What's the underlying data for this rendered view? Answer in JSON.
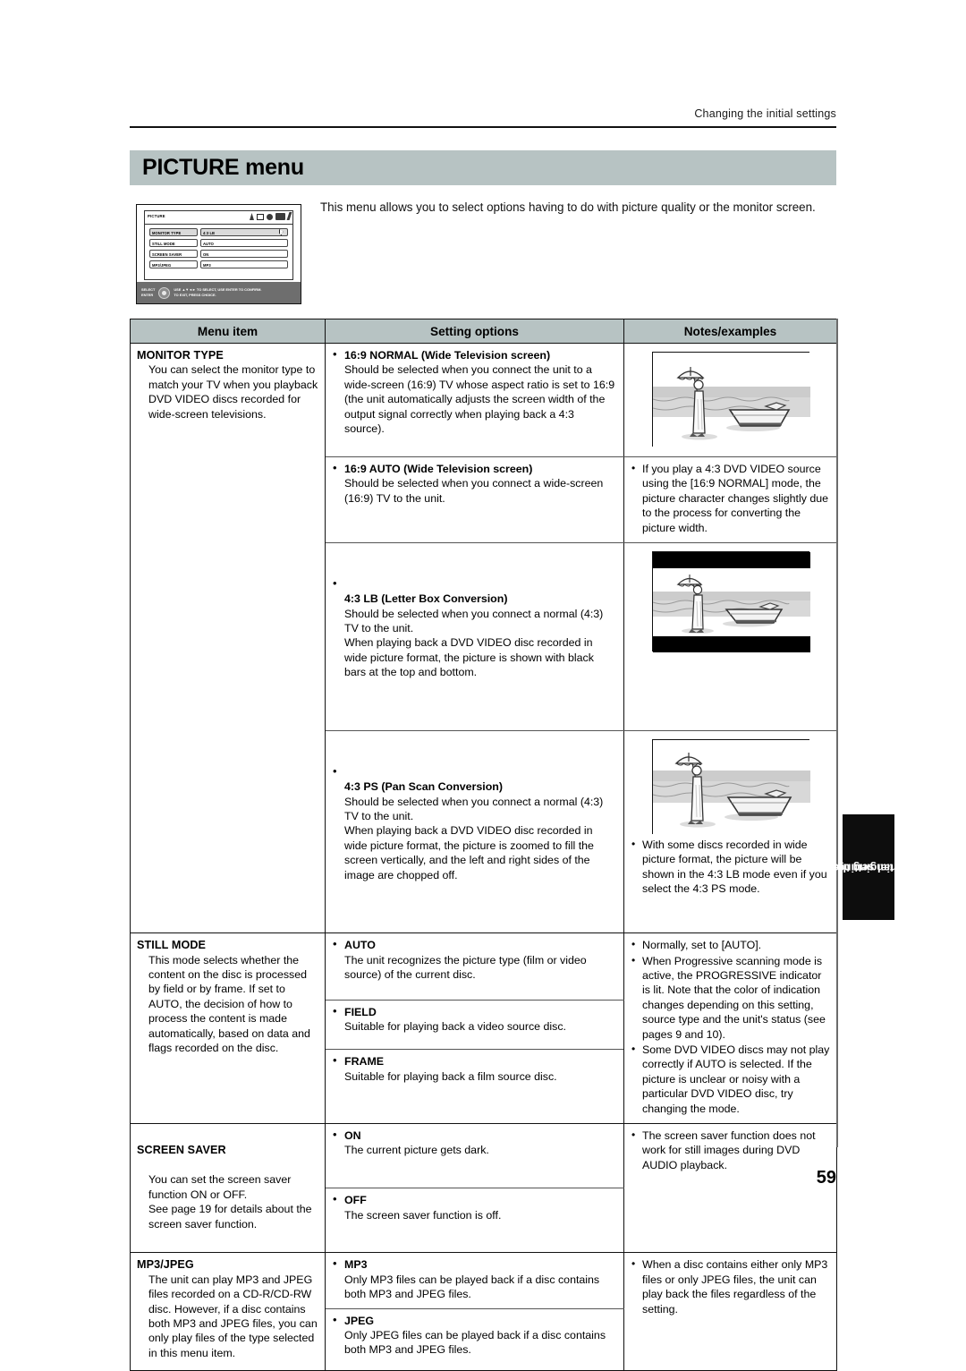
{
  "header": {
    "running_head": "Changing the initial settings"
  },
  "banner": {
    "title": "PICTURE menu"
  },
  "intro": {
    "text": "This menu allows you to select options having to do with picture quality or the monitor screen."
  },
  "osd": {
    "tab_label": "PICTURE",
    "tab_icons": [
      "speaker-icon",
      "monitor-icon",
      "disc-icon",
      "camera-icon",
      "pen-icon"
    ],
    "rows": [
      {
        "key": "MONITOR TYPE",
        "value": "4:3 LB",
        "selected": true
      },
      {
        "key": "STILL MODE",
        "value": "AUTO",
        "selected": false
      },
      {
        "key": "SCREEN SAVER",
        "value": "ON",
        "selected": false
      },
      {
        "key": "MP3/JPEG",
        "value": "MP3",
        "selected": false
      }
    ],
    "bar": {
      "key_select": "SELECT",
      "key_enter": "ENTER",
      "hint_line1": "USE ▲▼◄► TO SELECT, USE ENTER TO CONFIRM.",
      "hint_line2": "TO EXIT, PRESS CHOICE."
    }
  },
  "table": {
    "columns": [
      "Menu item",
      "Setting options",
      "Notes/examples"
    ],
    "rows": [
      {
        "menu_item": {
          "title": "MONITOR TYPE",
          "body": "You can select the monitor type to match your TV when you playback DVD VIDEO discs recorded for wide-screen televisions."
        },
        "blocks": [
          {
            "option_title": "16:9 NORMAL (Wide Television screen)",
            "option_desc": "Should be selected when you connect the unit to a wide-screen (16:9) TV whose aspect ratio is set to 16:9 (the unit automatically adjusts the screen width of the output signal correctly when playing back a 4:3 source).",
            "note_kind": "image",
            "note_image": "tv-16-9-normal"
          },
          {
            "option_title": "16:9 AUTO (Wide Television screen)",
            "option_desc": "Should be selected when you connect a wide-screen (16:9) TV to the unit.",
            "note_kind": "text",
            "notes": [
              "If you play a 4:3 DVD VIDEO source using the [16:9 NORMAL] mode, the picture character changes slightly due to the process for converting the picture width."
            ]
          },
          {
            "option_title": "4:3 LB (Letter Box Conversion)",
            "option_desc": "Should be selected when you connect a normal (4:3) TV to the unit.\nWhen playing back a DVD VIDEO disc recorded in wide picture format, the picture is shown with black bars at the top and bottom.",
            "note_kind": "image",
            "note_image": "tv-4-3-letterbox"
          },
          {
            "option_title": "4:3 PS (Pan Scan Conversion)",
            "option_desc": "Should be selected when you connect a normal (4:3) TV to the unit.\nWhen playing back a DVD VIDEO disc recorded in wide picture format, the picture is zoomed to fill the screen vertically, and the left and right sides of the image are chopped off.",
            "note_kind": "image+text",
            "note_image": "tv-4-3-panscan",
            "notes": [
              "With some discs recorded in wide picture format, the picture will be shown in the 4:3 LB mode even if you select the 4:3 PS mode."
            ]
          }
        ]
      },
      {
        "menu_item": {
          "title": "STILL MODE",
          "body": "This mode selects whether the content on the disc is processed by field or by frame. If set to AUTO, the decision of how to process the content is made automatically, based on data and flags recorded on the disc."
        },
        "options": [
          {
            "option_title": "AUTO",
            "option_desc": "The unit recognizes the picture type (film or video source) of the current disc."
          },
          {
            "option_title": "FIELD",
            "option_desc": "Suitable for playing back a video source disc."
          },
          {
            "option_title": "FRAME",
            "option_desc": "Suitable for playing back a film source disc."
          }
        ],
        "notes": [
          "Normally, set to [AUTO].",
          "When Progressive scanning mode is active, the PROGRESSIVE indicator is lit. Note that the color of indication changes depending on this setting, source type and the unit's status (see pages 9 and 10).",
          "Some DVD VIDEO discs may not play correctly if AUTO is selected. If the picture is unclear or noisy with a particular DVD VIDEO disc, try changing the mode."
        ]
      },
      {
        "menu_item": {
          "title": "SCREEN SAVER",
          "body": "You can set the screen saver function ON or OFF.\nSee page 19 for details about the screen saver function."
        },
        "options": [
          {
            "option_title": "ON",
            "option_desc": "The current picture gets dark."
          },
          {
            "option_title": "OFF",
            "option_desc": "The screen saver function is off."
          }
        ],
        "notes": [
          "The screen saver function does not work for still images during DVD AUDIO playback."
        ]
      },
      {
        "menu_item": {
          "title": "MP3/JPEG",
          "body": "The unit can play MP3 and JPEG files recorded on a CD-R/CD-RW disc. However, if a disc contains both MP3 and JPEG files, you can only play files of the type selected in this menu item."
        },
        "options": [
          {
            "option_title": "MP3",
            "option_desc": "Only MP3 files can be played back if a disc contains both MP3 and JPEG files."
          },
          {
            "option_title": "JPEG",
            "option_desc": "Only JPEG files can be played back if a disc contains both MP3 and JPEG files."
          }
        ],
        "notes": [
          "When a disc contains either only MP3 files or only JPEG files, the unit can play back the files regardless of the setting."
        ]
      }
    ]
  },
  "side_tab": {
    "line1": "Changing the",
    "line2": "initial settings"
  },
  "folio": {
    "page_number": "59"
  },
  "colors": {
    "banner_bg": "#b7c3c3",
    "table_header_bg": "#b7c3c3",
    "tab_bg": "#0d0d0d",
    "rule": "#111111"
  }
}
